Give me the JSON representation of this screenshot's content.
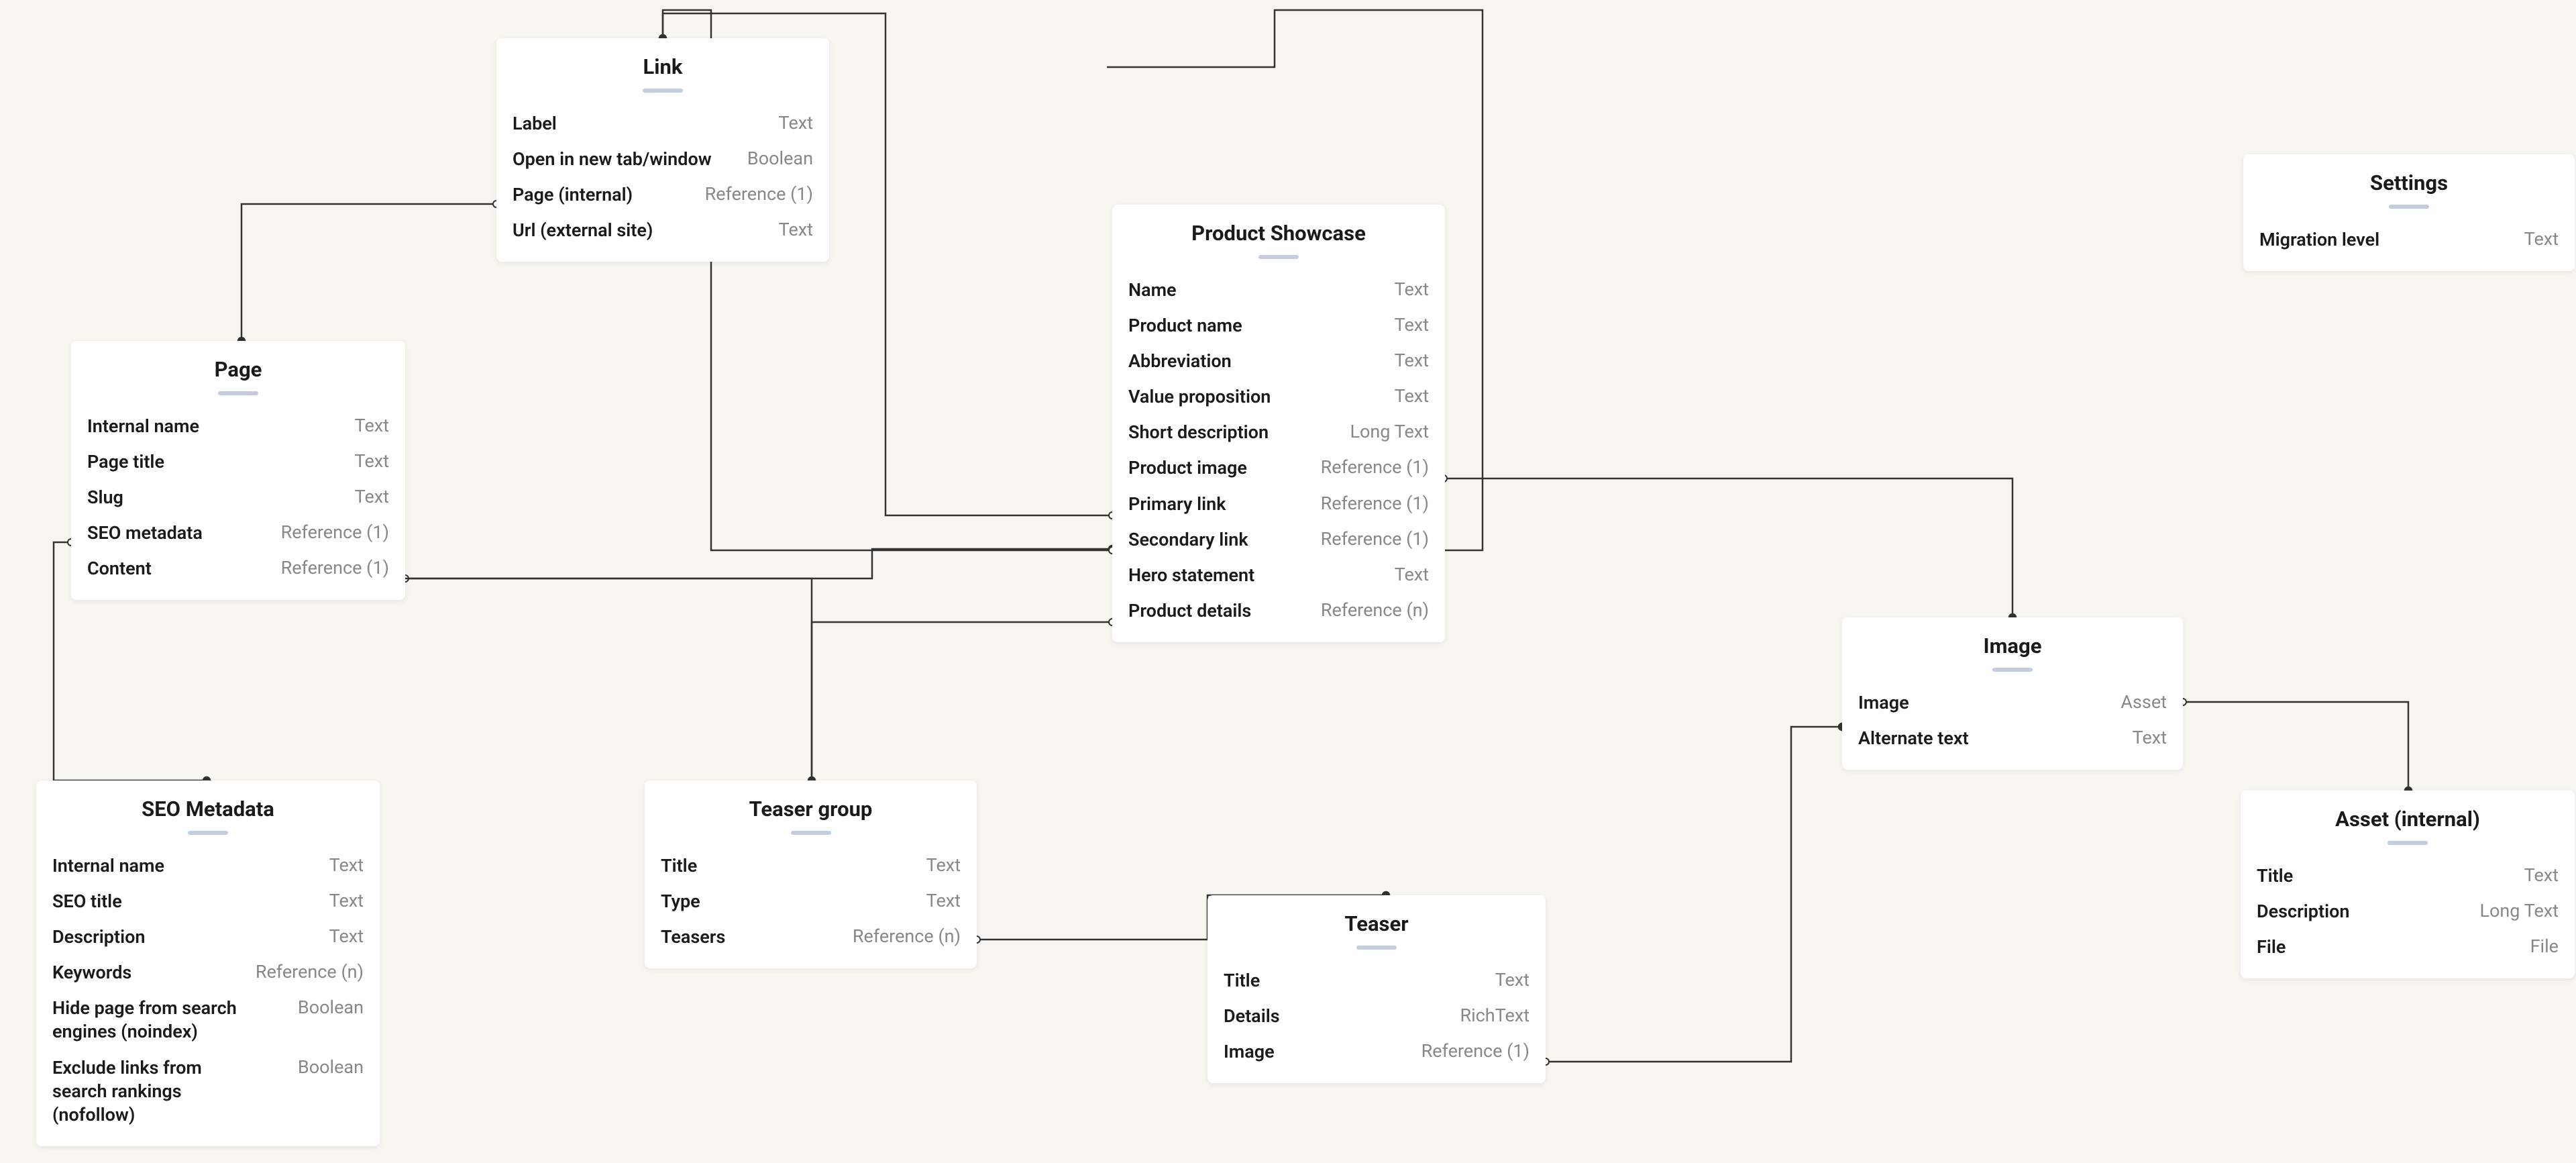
{
  "nodes": {
    "link": {
      "title": "Link",
      "fields": [
        {
          "name": "Label",
          "type": "Text"
        },
        {
          "name": "Open in new tab/window",
          "type": "Boolean"
        },
        {
          "name": "Page (internal)",
          "type": "Reference (1)"
        },
        {
          "name": "Url (external site)",
          "type": "Text"
        }
      ]
    },
    "settings": {
      "title": "Settings",
      "fields": [
        {
          "name": "Migration level",
          "type": "Text"
        }
      ]
    },
    "productShowcase": {
      "title": "Product Showcase",
      "fields": [
        {
          "name": "Name",
          "type": "Text"
        },
        {
          "name": "Product name",
          "type": "Text"
        },
        {
          "name": "Abbreviation",
          "type": "Text"
        },
        {
          "name": "Value proposition",
          "type": "Text"
        },
        {
          "name": "Short description",
          "type": "Long Text"
        },
        {
          "name": "Product image",
          "type": "Reference (1)"
        },
        {
          "name": "Primary link",
          "type": "Reference (1)"
        },
        {
          "name": "Secondary link",
          "type": "Reference (1)"
        },
        {
          "name": "Hero statement",
          "type": "Text"
        },
        {
          "name": "Product details",
          "type": "Reference (n)"
        }
      ]
    },
    "page": {
      "title": "Page",
      "fields": [
        {
          "name": "Internal name",
          "type": "Text"
        },
        {
          "name": "Page title",
          "type": "Text"
        },
        {
          "name": "Slug",
          "type": "Text"
        },
        {
          "name": "SEO metadata",
          "type": "Reference (1)"
        },
        {
          "name": "Content",
          "type": "Reference (1)"
        }
      ]
    },
    "image": {
      "title": "Image",
      "fields": [
        {
          "name": "Image",
          "type": "Asset"
        },
        {
          "name": "Alternate text",
          "type": "Text"
        }
      ]
    },
    "seoMetadata": {
      "title": "SEO Metadata",
      "fields": [
        {
          "name": "Internal name",
          "type": "Text"
        },
        {
          "name": "SEO title",
          "type": "Text"
        },
        {
          "name": "Description",
          "type": "Text"
        },
        {
          "name": "Keywords",
          "type": "Reference (n)"
        },
        {
          "name": "Hide page from search engines (noindex)",
          "type": "Boolean"
        },
        {
          "name": "Exclude links from search rankings (nofollow)",
          "type": "Boolean"
        }
      ]
    },
    "teaserGroup": {
      "title": "Teaser group",
      "fields": [
        {
          "name": "Title",
          "type": "Text"
        },
        {
          "name": "Type",
          "type": "Text"
        },
        {
          "name": "Teasers",
          "type": "Reference (n)"
        }
      ]
    },
    "teaser": {
      "title": "Teaser",
      "fields": [
        {
          "name": "Title",
          "type": "Text"
        },
        {
          "name": "Details",
          "type": "RichText"
        },
        {
          "name": "Image",
          "type": "Reference (1)"
        }
      ]
    },
    "asset": {
      "title": "Asset (internal)",
      "fields": [
        {
          "name": "Title",
          "type": "Text"
        },
        {
          "name": "Description",
          "type": "Long Text"
        },
        {
          "name": "File",
          "type": "File"
        }
      ]
    }
  }
}
